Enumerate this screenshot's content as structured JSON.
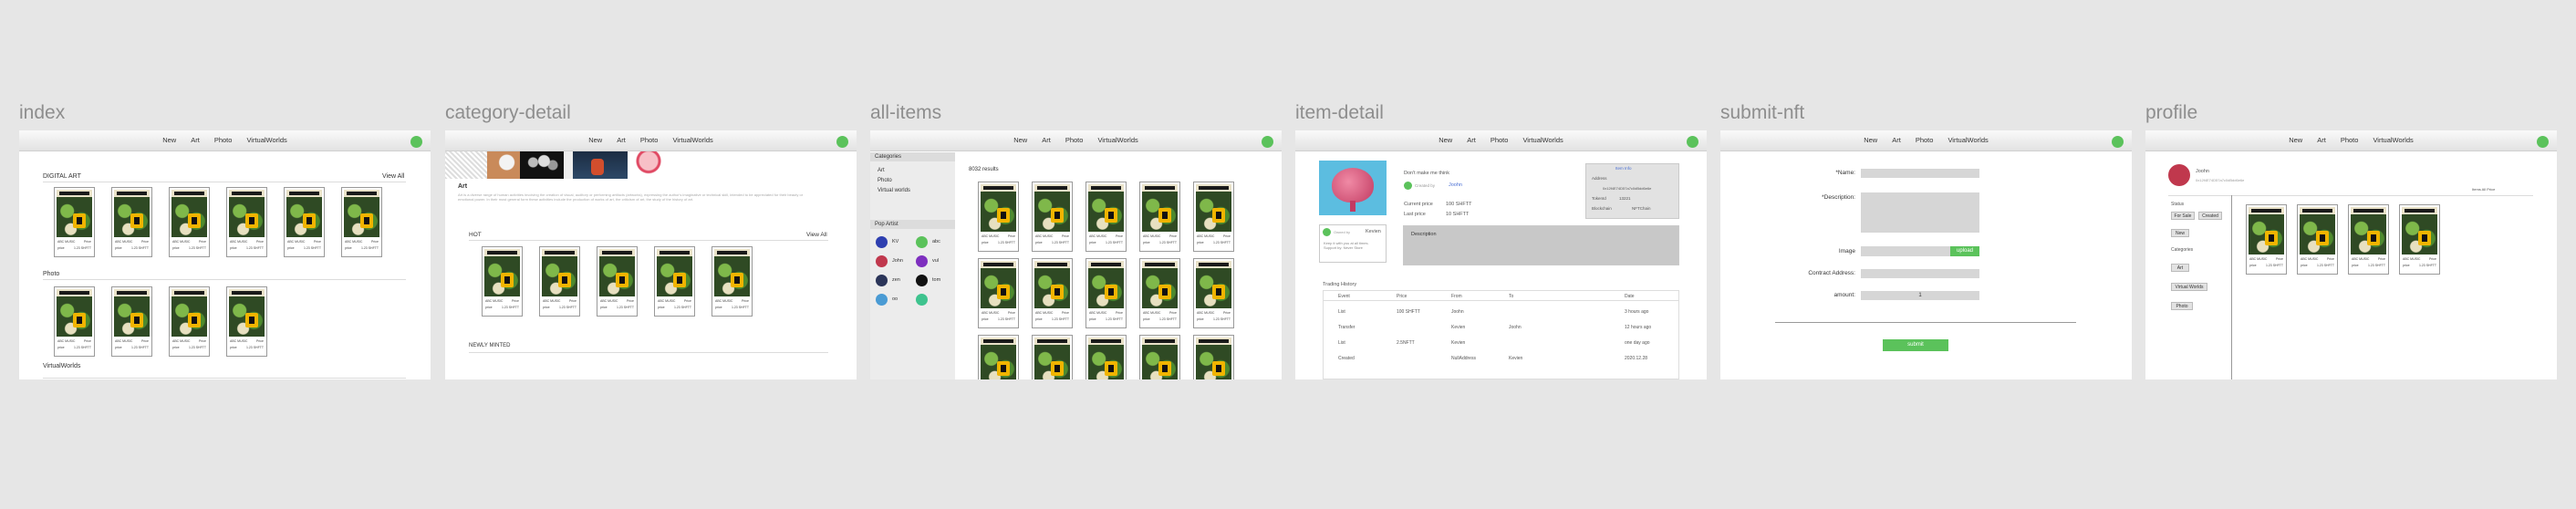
{
  "frame_titles": [
    "index",
    "category-detail",
    "all-items",
    "item-detail",
    "submit-nft",
    "profile"
  ],
  "nav": {
    "items": [
      "New",
      "Art",
      "Photo",
      "VirtualWorlds"
    ]
  },
  "card": {
    "meta1": "ABC MUSIC",
    "meta1r": "Price",
    "meta2": "price",
    "meta2r": "1.23 SHFTT"
  },
  "index": {
    "digital_art": "DIGITAL ART",
    "view_all": "View All",
    "photo": "Photo",
    "virtual_worlds": "VirtualWorlds"
  },
  "category": {
    "heading": "Art",
    "description": "Art is a diverse range of human activities involving the creation of visual, auditory or performing artifacts (artworks), expressing the author's imaginative or technical skill, intended to be appreciated for their beauty or emotional power. In their most general form these activities include the production of works of art, the criticism of art, the study of the history of art.",
    "hot": "HOT",
    "view_all": "View All",
    "newly_minted": "NEWLY MINTED"
  },
  "all_items": {
    "categories_label": "Categories",
    "categories": [
      "Art",
      "Photo",
      "Virtual worlds"
    ],
    "pop_artist_label": "Pop Artist",
    "artists": [
      {
        "name": "KV",
        "color": "#2e3fb0"
      },
      {
        "name": "abc",
        "color": "#5bc25b"
      },
      {
        "name": "John",
        "color": "#c0384d"
      },
      {
        "name": "vul",
        "color": "#7e2fbf"
      },
      {
        "name": "zen",
        "color": "#2b3559"
      },
      {
        "name": "tom",
        "color": "#111111"
      },
      {
        "name": "oo",
        "color": "#4a9bd4"
      },
      {
        "name": "",
        "color": "#3ec38e"
      }
    ],
    "results": "8032 results"
  },
  "item_detail": {
    "created_by_label": "Created by",
    "creator": "Joohn",
    "right_title": "Don't make me think",
    "current_price_label": "Current price",
    "current_price": "100 SHFTT",
    "last_price_label": "Last price",
    "last_price": "10 SHFTT",
    "details_label": "Item Info",
    "address_label": "Address",
    "address": "0x12f4E74D57a7c0dBdd6e6e",
    "tokenid_label": "TokenId",
    "tokenid": "13221",
    "blockchain_label": "Blockchain",
    "blockchain": "NFTChain",
    "owner_label": "Owned by",
    "owner": "Kevien",
    "owner_bio": "Keep it with you at all times. Support by: Never Store",
    "description_label": "Description",
    "trading_history": "Trading History",
    "columns": [
      "Event",
      "Price",
      "From",
      "To",
      "Date"
    ],
    "rows": [
      [
        "List",
        "100 SHFTT",
        "Joohn",
        "",
        "3 hours ago"
      ],
      [
        "Transfer",
        "",
        "Kevien",
        "Joohn",
        "12 hours ago"
      ],
      [
        "List",
        "2.5NFTT",
        "Kevien",
        "",
        "one day ago"
      ],
      [
        "Created",
        "",
        "NullAddress",
        "Kevien",
        "2020.12.28"
      ]
    ]
  },
  "submit": {
    "name_label": "*Name:",
    "description_label": "*Description:",
    "image_label": "Image",
    "upload": "upload",
    "contract_label": "Contract Address:",
    "amount_label": "amount:",
    "amount_value": "1",
    "submit": "submit"
  },
  "profile": {
    "name": "Joohn",
    "address": "0x12f4E74D57a7c0dBdd6e6e",
    "tabs": "Items All   Price",
    "status_label": "Status",
    "status_buttons": [
      "For Sale",
      "Created",
      "New"
    ],
    "categories_label": "Categories",
    "category_buttons": [
      "Art",
      "Virtual Worlds",
      "Photo"
    ]
  }
}
